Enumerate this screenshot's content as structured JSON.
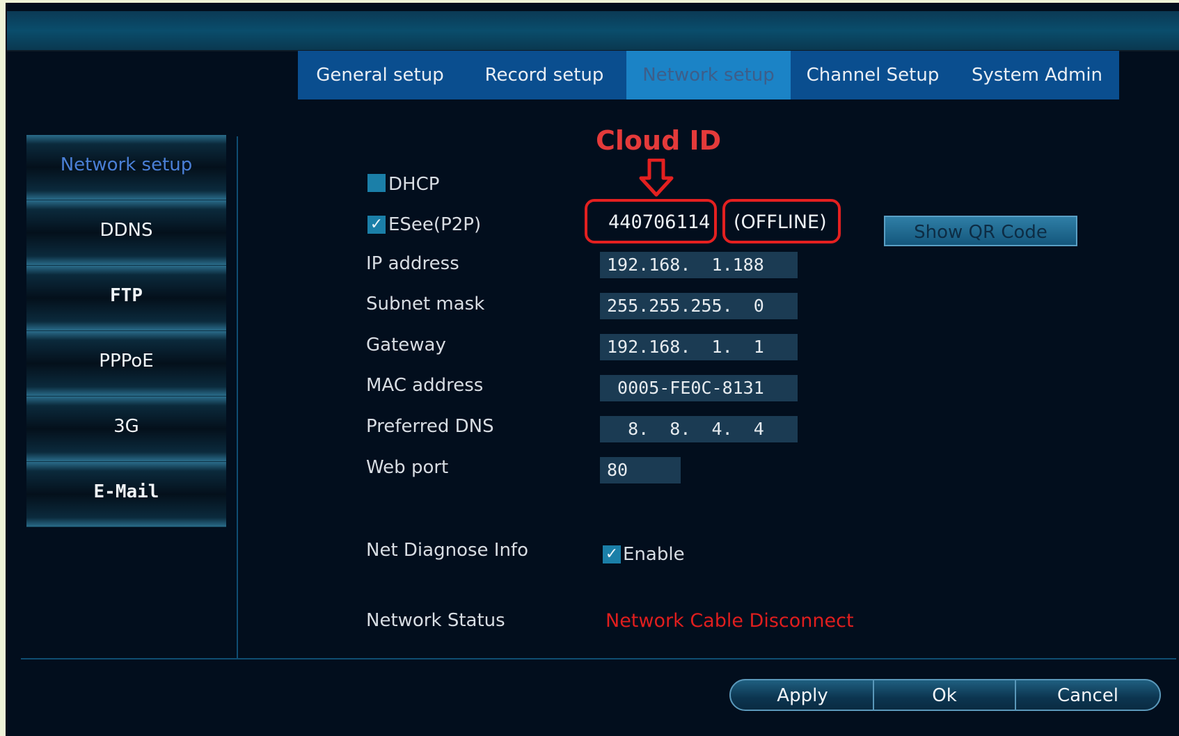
{
  "tabs": [
    "General setup",
    "Record setup",
    "Network setup",
    "Channel Setup",
    "System Admin"
  ],
  "active_tab": "Network setup",
  "sidebar": {
    "items": [
      "Network setup",
      "DDNS",
      "FTP",
      "PPPoE",
      "3G",
      "E-Mail"
    ],
    "active": "Network setup"
  },
  "annotation": {
    "title": "Cloud ID"
  },
  "form": {
    "dhcp_label": "DHCP",
    "dhcp_checked": false,
    "esee_label": "ESee(P2P)",
    "esee_checked": true,
    "cloud_id": "440706114",
    "cloud_status": "(OFFLINE)",
    "qr_button": "Show QR Code",
    "ip_label": "IP address",
    "ip_value": "192.168.  1.188",
    "subnet_label": "Subnet mask",
    "subnet_value": "255.255.255.  0",
    "gateway_label": "Gateway",
    "gateway_value": "192.168.  1.  1",
    "mac_label": "MAC address",
    "mac_value": " 0005-FE0C-8131",
    "dns_label": "Preferred DNS",
    "dns_value": "  8.  8.  4.  4",
    "port_label": "Web port",
    "port_value": "80",
    "diag_label": "Net Diagnose Info",
    "diag_enable_label": "Enable",
    "diag_checked": true,
    "status_label": "Network Status",
    "status_value": "Network Cable Disconnect"
  },
  "buttons": {
    "apply": "Apply",
    "ok": "Ok",
    "cancel": "Cancel"
  },
  "colors": {
    "background": "#020e1d",
    "tab_bar": "#0a4e8f",
    "accent": "#1b83c6",
    "alert": "#e01e1e"
  }
}
